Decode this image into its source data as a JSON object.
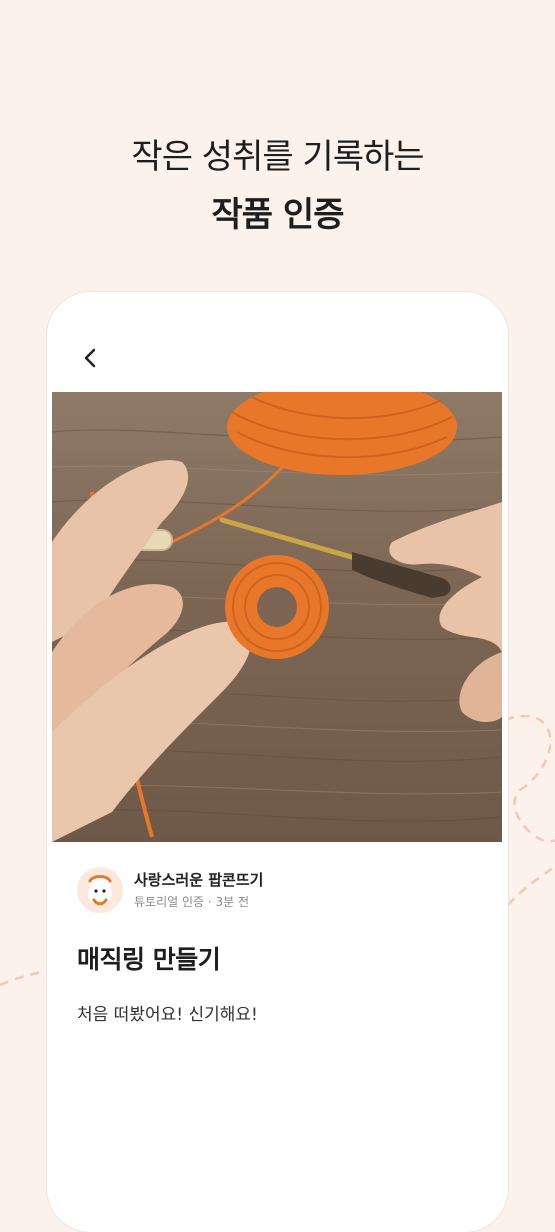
{
  "headline": {
    "line1": "작은 성취를 기록하는",
    "line2": "작품 인증"
  },
  "nav": {
    "back_icon": "chevron-left-icon"
  },
  "post": {
    "photo_subject": "",
    "author_name": "사랑스러운 팝콘뜨기",
    "category": "튜토리얼 인증",
    "separator": "·",
    "time_ago": "3분 전",
    "title": "매직링 만들기",
    "body": "처음 떠봤어요! 신기해요!"
  },
  "colors": {
    "background": "#fbf2ec",
    "accent": "#e8772a",
    "card": "#ffffff"
  }
}
